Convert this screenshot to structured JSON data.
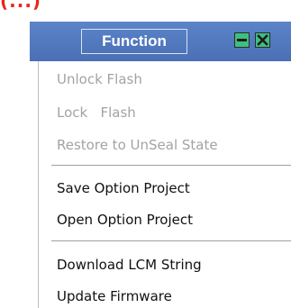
{
  "top_fragment": "(...)",
  "title_bar": {
    "title": "Function",
    "minimize_icon": "minimize-icon",
    "close_icon": "close-icon",
    "icon_color": "#3fbf7f"
  },
  "menu": {
    "items": [
      {
        "label": "Unlock Flash",
        "enabled": false
      },
      {
        "label": "Lock   Flash",
        "enabled": false
      },
      {
        "label": "Restore to UnSeal State",
        "enabled": false
      },
      {
        "label": "Save Option Project",
        "enabled": true
      },
      {
        "label": "Open Option Project",
        "enabled": true
      },
      {
        "label": "Download LCM String",
        "enabled": true
      },
      {
        "label": "Update Firmware",
        "enabled": true
      }
    ]
  }
}
